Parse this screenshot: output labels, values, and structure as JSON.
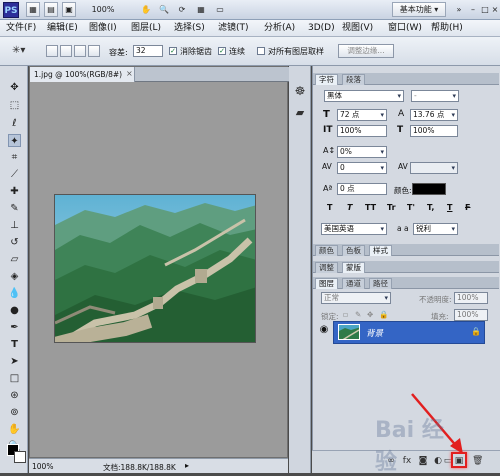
{
  "app": {
    "logo": "PS",
    "topbar": {
      "zoom": "100%",
      "workspace": "基本功能"
    },
    "menus": [
      "文件(F)",
      "编辑(E)",
      "图像(I)",
      "图层(L)",
      "选择(S)",
      "滤镜(T)",
      "分析(A)",
      "3D(D)",
      "视图(V)",
      "窗口(W)",
      "帮助(H)"
    ]
  },
  "options": {
    "tolerance_label": "容差:",
    "tolerance_value": "32",
    "antialias_label": "消除锯齿",
    "contiguous_label": "连续",
    "all_layers_label": "对所有图层取样",
    "refine_button": "调整边缘..."
  },
  "document": {
    "tab_title": "1.jpg @ 100%(RGB/8#)",
    "status_zoom": "100%",
    "status_doc": "文档:188.8K/188.8K"
  },
  "character_panel": {
    "tabs": [
      "字符",
      "段落"
    ],
    "font_family": "黑体",
    "font_style": "-",
    "font_size": "72 点",
    "leading": "13.76 点",
    "vertical_scale": "100%",
    "horizontal_scale": "100%",
    "baseline_shift_pct": "0%",
    "tracking": "0",
    "kerning": "",
    "baseline_shift": "0 点",
    "color_label": "颜色:",
    "language": "美国英语",
    "aa_label": "a a",
    "aa_method": "锐利",
    "color": "#000000",
    "text_styles": [
      "T",
      "T",
      "TT",
      "Tr",
      "T'",
      "T,",
      "T",
      "F"
    ]
  },
  "other_panels": {
    "tabs_row1": [
      "颜色",
      "色板",
      "样式"
    ],
    "tabs_row2": [
      "调整",
      "蒙版"
    ],
    "tabs_row3": [
      "图层",
      "通道",
      "路径"
    ]
  },
  "layers_panel": {
    "blend_mode": "正常",
    "opacity_label": "不透明度:",
    "opacity": "100%",
    "lock_label": "锁定:",
    "fill_label": "填充:",
    "fill": "100%",
    "layer_name": "背景"
  },
  "watermark": "Bai 经验",
  "colors": {
    "layer_selected": "#3465c5",
    "highlight": "#e21f1f"
  }
}
